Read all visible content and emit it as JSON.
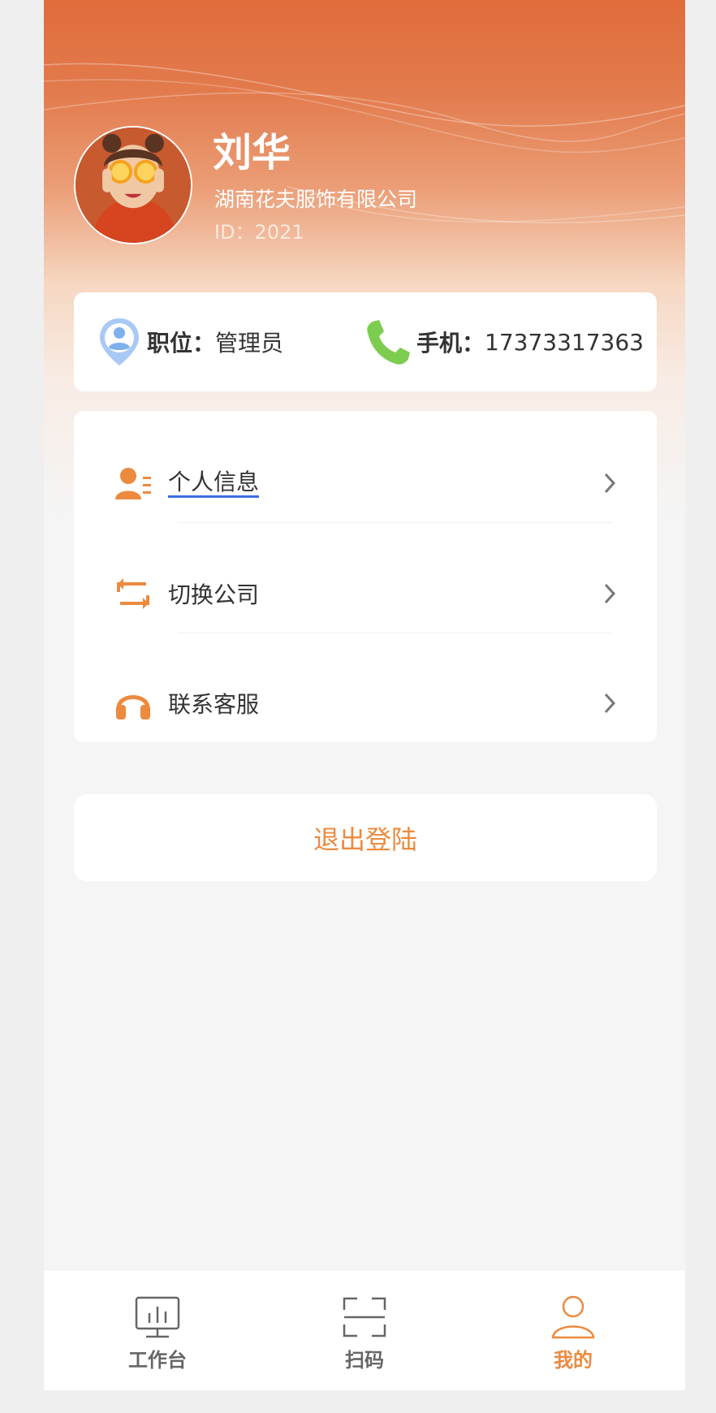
{
  "profile": {
    "name": "刘华",
    "company": "湖南花夫服饰有限公司",
    "id_text": "ID：2021"
  },
  "info": {
    "position_label": "职位",
    "position_value": "管理员",
    "phone_label": "手机",
    "phone_value": "17373317363",
    "colon": "："
  },
  "menu": {
    "items": [
      {
        "label": "个人信息",
        "icon": "personal-info-icon"
      },
      {
        "label": "切换公司",
        "icon": "switch-icon"
      },
      {
        "label": "联系客服",
        "icon": "headset-icon"
      }
    ]
  },
  "logout_label": "退出登陆",
  "tabbar": {
    "tabs": [
      {
        "label": "工作台",
        "icon": "workbench-icon",
        "active": false
      },
      {
        "label": "扫码",
        "icon": "scan-icon",
        "active": false
      },
      {
        "label": "我的",
        "icon": "user-icon",
        "active": true
      }
    ]
  },
  "colors": {
    "accent": "#ec8a3e",
    "header_top": "#e06c3c",
    "phone_icon": "#7ccd4f",
    "location_icon": "#8bb8f0",
    "link_underline": "#3a6fe0"
  }
}
